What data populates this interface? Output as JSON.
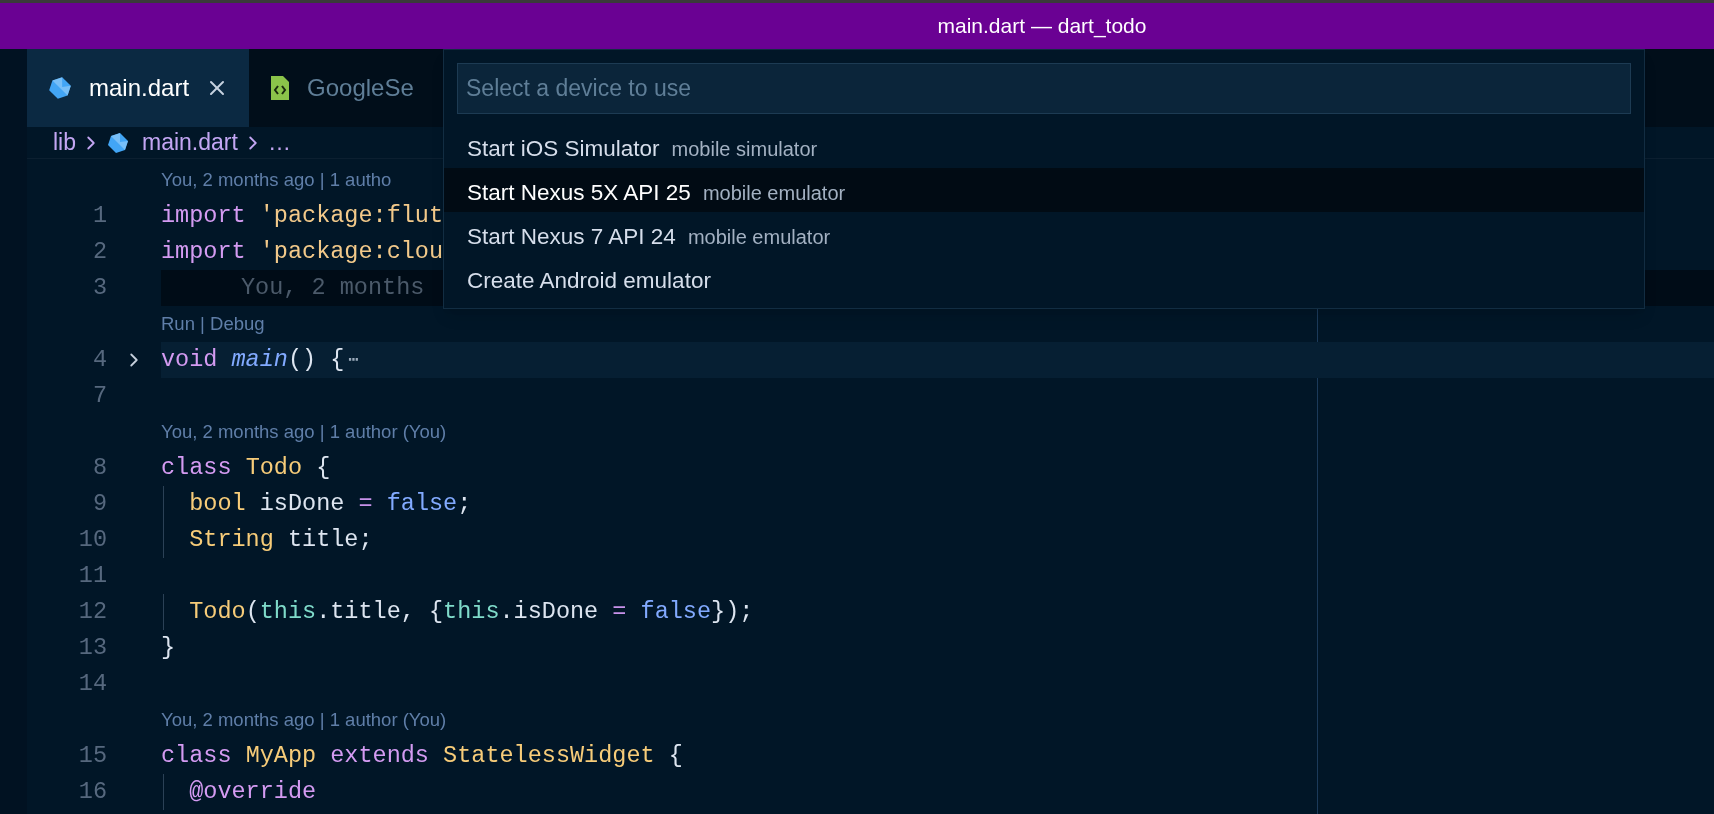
{
  "window": {
    "title": "main.dart — dart_todo"
  },
  "tabs": [
    {
      "label": "main.dart",
      "selected": true,
      "kind": "dart"
    },
    {
      "label": "GoogleSe",
      "selected": false,
      "kind": "code"
    }
  ],
  "breadcrumb": [
    {
      "label": "lib",
      "kind": "folder"
    },
    {
      "label": "main.dart",
      "kind": "dart"
    },
    {
      "label": "…",
      "kind": "more"
    }
  ],
  "editor": {
    "lines": [
      {
        "kind": "lens",
        "text": "You, 2 months ago | 1 autho"
      },
      {
        "kind": "code",
        "number": "1",
        "tokens": [
          {
            "text": "import ",
            "kind": "kw"
          },
          {
            "text": "'package:flut",
            "kind": "str"
          }
        ]
      },
      {
        "kind": "code",
        "number": "2",
        "tokens": [
          {
            "text": "import ",
            "kind": "kw"
          },
          {
            "text": "'package:clou",
            "kind": "str"
          }
        ]
      },
      {
        "kind": "code",
        "number": "3",
        "current": true,
        "ghost": "You, 2 months"
      },
      {
        "kind": "lens",
        "text": "Run | Debug"
      },
      {
        "kind": "code",
        "number": "4",
        "folded": true,
        "fold_marker": "⋯",
        "tokens": [
          {
            "text": "void ",
            "kind": "kw"
          },
          {
            "text": "main",
            "kind": "fn"
          },
          {
            "text": "() {",
            "kind": "plain"
          }
        ]
      },
      {
        "kind": "code",
        "number": "7"
      },
      {
        "kind": "lens",
        "text": "You, 2 months ago | 1 author (You)"
      },
      {
        "kind": "code",
        "number": "8",
        "tokens": [
          {
            "text": "class ",
            "kind": "kw"
          },
          {
            "text": "Todo",
            "kind": "type"
          },
          {
            "text": " {",
            "kind": "plain"
          }
        ]
      },
      {
        "kind": "code",
        "number": "9",
        "tokens": [
          {
            "text": "  bool",
            "kind": "type"
          },
          {
            "text": " isDone ",
            "kind": "plain"
          },
          {
            "text": "= ",
            "kind": "op"
          },
          {
            "text": "false",
            "kind": "lit"
          },
          {
            "text": ";",
            "kind": "plain"
          }
        ]
      },
      {
        "kind": "code",
        "number": "10",
        "tokens": [
          {
            "text": "  String",
            "kind": "type"
          },
          {
            "text": " title;",
            "kind": "plain"
          }
        ]
      },
      {
        "kind": "code",
        "number": "11"
      },
      {
        "kind": "code",
        "number": "12",
        "tokens": [
          {
            "text": "  Todo",
            "kind": "type"
          },
          {
            "text": "(",
            "kind": "plain"
          },
          {
            "text": "this",
            "kind": "this"
          },
          {
            "text": ".title, {",
            "kind": "plain"
          },
          {
            "text": "this",
            "kind": "this"
          },
          {
            "text": ".isDone ",
            "kind": "plain"
          },
          {
            "text": "= ",
            "kind": "op"
          },
          {
            "text": "false",
            "kind": "lit"
          },
          {
            "text": "});",
            "kind": "plain"
          }
        ]
      },
      {
        "kind": "code",
        "number": "13",
        "tokens": [
          {
            "text": "}",
            "kind": "plain"
          }
        ]
      },
      {
        "kind": "code",
        "number": "14"
      },
      {
        "kind": "lens",
        "text": "You, 2 months ago | 1 author (You)"
      },
      {
        "kind": "code",
        "number": "15",
        "tokens": [
          {
            "text": "class ",
            "kind": "kw"
          },
          {
            "text": "MyApp ",
            "kind": "type"
          },
          {
            "text": "extends ",
            "kind": "kw"
          },
          {
            "text": "StatelessWidget",
            "kind": "type"
          },
          {
            "text": " {",
            "kind": "plain"
          }
        ]
      },
      {
        "kind": "code",
        "number": "16",
        "tokens": [
          {
            "text": "  @override",
            "kind": "kw"
          }
        ]
      }
    ]
  },
  "quick_pick": {
    "placeholder": "Select a device to use",
    "items": [
      {
        "label": "Start iOS Simulator",
        "description": "mobile simulator",
        "selected": false
      },
      {
        "label": "Start Nexus 5X API 25",
        "description": "mobile emulator",
        "selected": true
      },
      {
        "label": "Start Nexus 7 API 24",
        "description": "mobile emulator",
        "selected": false
      },
      {
        "label": "Create Android emulator",
        "selected": false
      }
    ]
  }
}
